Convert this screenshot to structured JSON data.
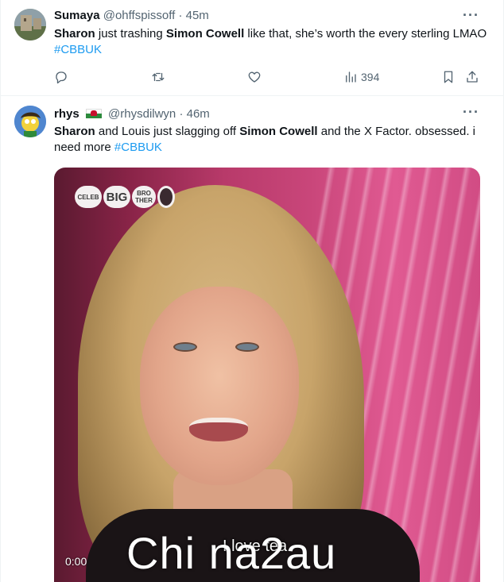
{
  "tweets": [
    {
      "name": "Sumaya",
      "handle": "@ohffspissoff",
      "separator": "·",
      "time": "45m",
      "text": {
        "p1": "Sharon",
        "p2": " just trashing ",
        "p3": "Simon Cowell",
        "p4": " like that, she’s worth the every sterling LMAO ",
        "hashtag": "#CBBUK"
      },
      "views": "394",
      "icons": [
        "reply-icon",
        "retweet-icon",
        "like-icon",
        "views-icon",
        "bookmark-icon",
        "share-icon"
      ]
    },
    {
      "name": "rhys",
      "handle": "@rhysdilwyn",
      "separator": "·",
      "time": "46m",
      "text": {
        "p1": "Sharon",
        "p2": " and Louis just slagging off ",
        "p3": "Simon Cowell",
        "p4": " and the X Factor. obsessed. i need more ",
        "hashtag": "#CBBUK"
      },
      "video": {
        "logo": {
          "celeb": "CELEB",
          "big": "BIG",
          "brother": "BRO THER"
        },
        "subtitle": "I love tea",
        "timecode": "0:00"
      }
    }
  ],
  "watermark": "Chi na2au",
  "colors": {
    "link": "#1d9bf0",
    "muted": "#536471",
    "text": "#0f1419",
    "border": "#eff3f4"
  }
}
